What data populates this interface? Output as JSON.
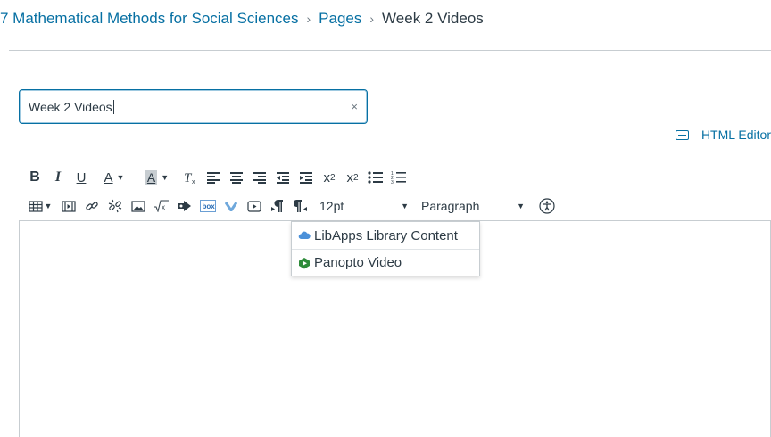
{
  "breadcrumb": {
    "course": "7 Mathematical Methods for Social Sciences",
    "pages": "Pages",
    "current": "Week 2 Videos",
    "separator": "›"
  },
  "title_field": {
    "value": "Week 2 Videos",
    "clear_glyph": "×"
  },
  "html_editor": {
    "label": "HTML Editor",
    "icon": "keyboard-icon"
  },
  "toolbar": {
    "bold": "B",
    "italic": "I",
    "underline": "U",
    "text_color": "A",
    "background_color": "A",
    "superscript": "x",
    "subscript": "x",
    "font_size": "12pt",
    "block_format": "Paragraph"
  },
  "dropdown": {
    "items": [
      {
        "label": "LibApps Library Content",
        "icon": "cloud-icon",
        "color": "#4a90d9"
      },
      {
        "label": "Panopto Video",
        "icon": "panopto-icon",
        "color": "#2e8b3a"
      }
    ]
  },
  "colors": {
    "link": "#0770a3",
    "text": "#2d3b45",
    "border": "#c7cdd1"
  }
}
